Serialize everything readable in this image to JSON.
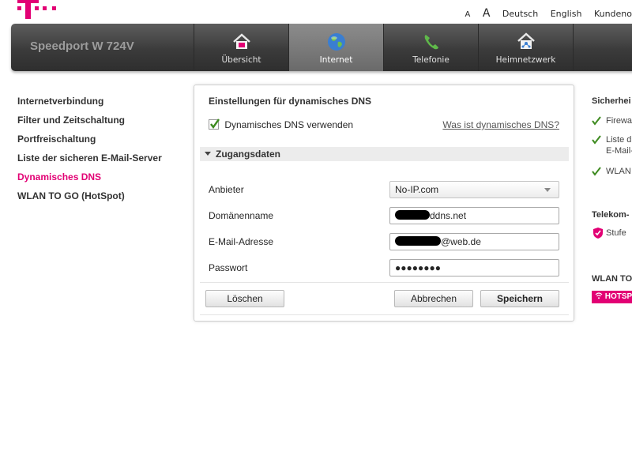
{
  "brand": {
    "logo_icon": "telekom-t-logo-icon",
    "color": "#e20074"
  },
  "top_links": {
    "font_small": "A",
    "font_large": "A",
    "deutsch": "Deutsch",
    "english": "English",
    "kundencenter": "Kundeno"
  },
  "header": {
    "product_name": "Speedport W 724V",
    "tabs": [
      {
        "label": "Übersicht",
        "icon": "house-icon",
        "active": false
      },
      {
        "label": "Internet",
        "icon": "globe-icon",
        "active": true
      },
      {
        "label": "Telefonie",
        "icon": "phone-icon",
        "active": false
      },
      {
        "label": "Heimnetzwerk",
        "icon": "home-network-icon",
        "active": false
      }
    ]
  },
  "left_nav": {
    "items": [
      {
        "label": "Internetverbindung",
        "active": false
      },
      {
        "label": "Filter und Zeitschaltung",
        "active": false
      },
      {
        "label": "Portfreischaltung",
        "active": false
      },
      {
        "label": "Liste der sicheren E-Mail-Server",
        "active": false
      },
      {
        "label": "Dynamisches DNS",
        "active": true
      },
      {
        "label": "WLAN TO GO (HotSpot)",
        "active": false
      }
    ]
  },
  "panel": {
    "title": "Einstellungen für dynamisches DNS",
    "use_dns_checkbox_label": "Dynamisches DNS verwenden",
    "use_dns_checked": true,
    "help_link": "Was ist dynamisches DNS?",
    "section_title": "Zugangsdaten",
    "fields": {
      "provider": {
        "label": "Anbieter",
        "value": "No-IP.com"
      },
      "domain": {
        "label": "Domänenname",
        "value_visible": "ddns.net"
      },
      "email": {
        "label": "E-Mail-Adresse",
        "value_visible": "@web.de"
      },
      "password": {
        "label": "Passwort",
        "value": "●●●●●●●●"
      }
    },
    "buttons": {
      "delete": "Löschen",
      "cancel": "Abbrechen",
      "save": "Speichern"
    }
  },
  "right_col": {
    "security_head": "Sicherhei",
    "security_items": [
      "Firewa",
      "Liste d",
      "E-Mail-",
      "WLAN"
    ],
    "telekom_head": "Telekom-",
    "telekom_item": "Stufe",
    "wlan_head": "WLAN TO",
    "hotspot_badge": "HOTSPO"
  }
}
